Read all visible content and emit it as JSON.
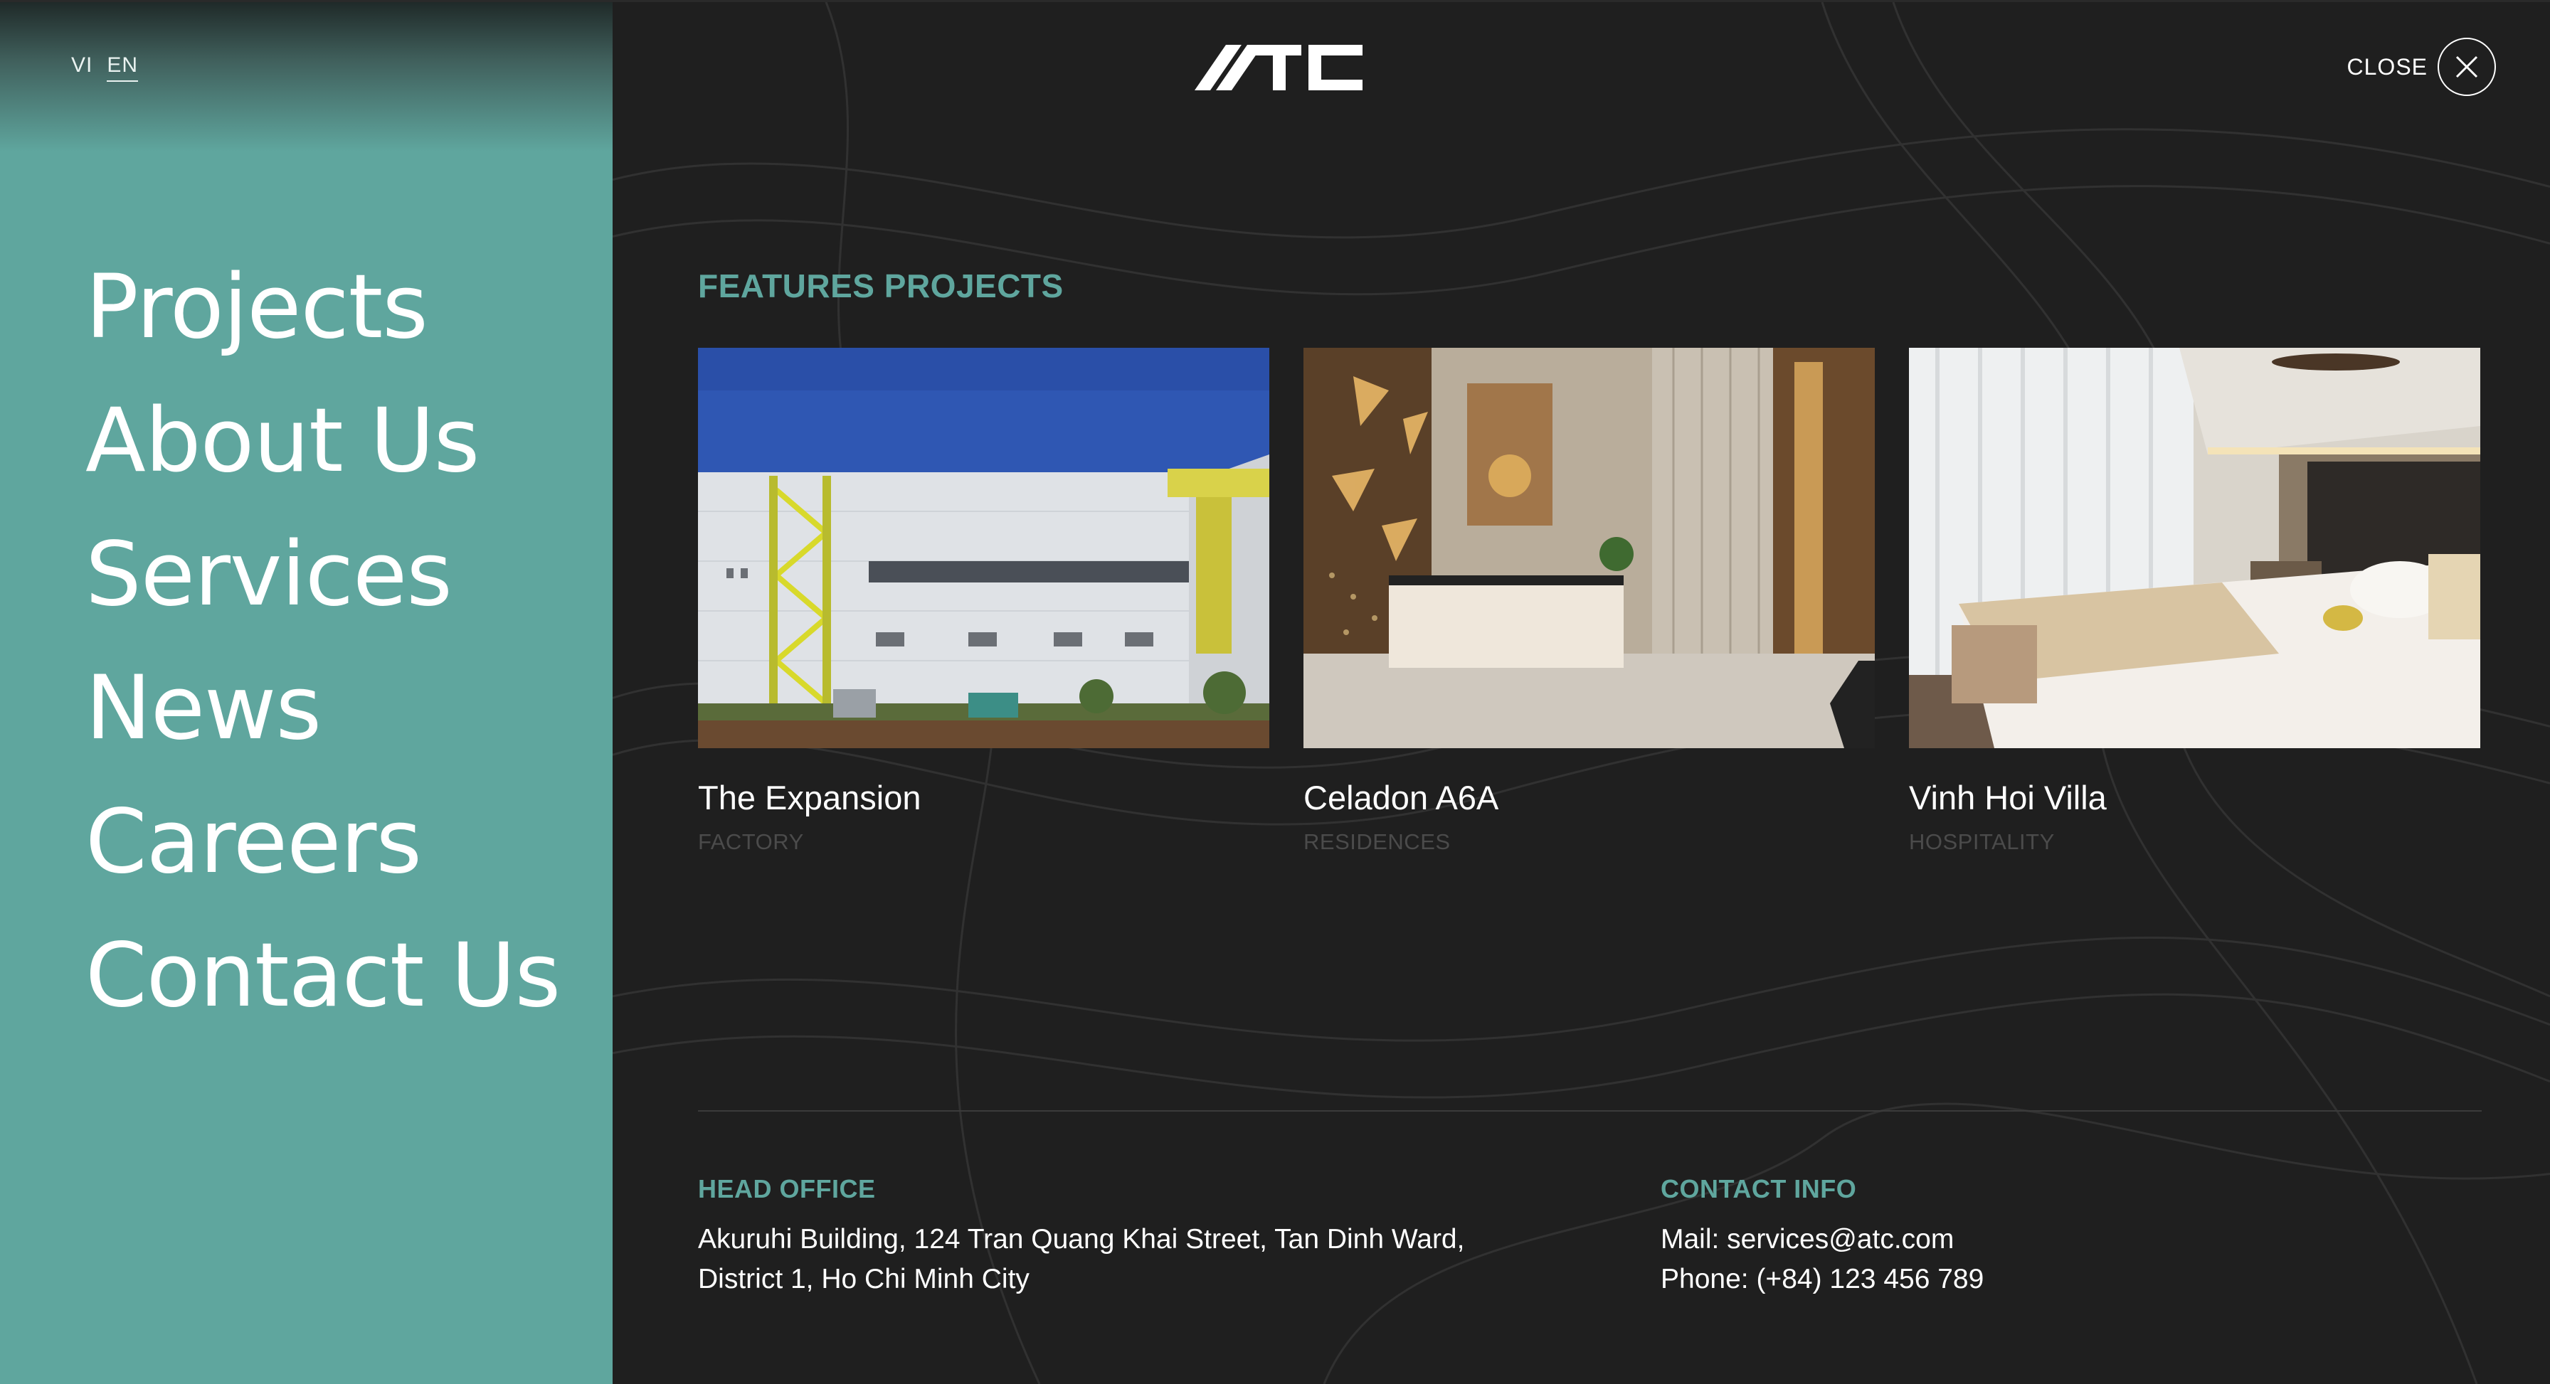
{
  "language": {
    "options": [
      "VI",
      "EN"
    ],
    "selected": "EN"
  },
  "nav": {
    "items": [
      {
        "label": "Projects"
      },
      {
        "label": "About Us"
      },
      {
        "label": "Services"
      },
      {
        "label": "News"
      },
      {
        "label": "Careers"
      },
      {
        "label": "Contact Us"
      }
    ]
  },
  "header": {
    "logo_text": "ATC",
    "close_label": "CLOSE"
  },
  "features": {
    "title": "FEATURES PROJECTS",
    "projects": [
      {
        "title": "The Expansion",
        "category": "FACTORY"
      },
      {
        "title": "Celadon A6A",
        "category": "RESIDENCES"
      },
      {
        "title": "Vinh Hoi Villa",
        "category": "HOSPITALITY"
      }
    ]
  },
  "footer": {
    "head_office": {
      "heading": "HEAD OFFICE",
      "line1": "Akuruhi Building, 124 Tran Quang Khai Street, Tan Dinh Ward,",
      "line2": "District 1, Ho Chi Minh City"
    },
    "contact_info": {
      "heading": "CONTACT INFO",
      "mail": "Mail: services@atc.com",
      "phone": "Phone: (+84) 123 456 789"
    }
  },
  "colors": {
    "accent": "#5fa69e",
    "panel_dark": "#1f1f1f",
    "text_light": "#ffffff",
    "text_muted": "#4b4b4b"
  },
  "icons": {
    "close": "close-x-icon",
    "logo": "atc-logo-icon"
  }
}
